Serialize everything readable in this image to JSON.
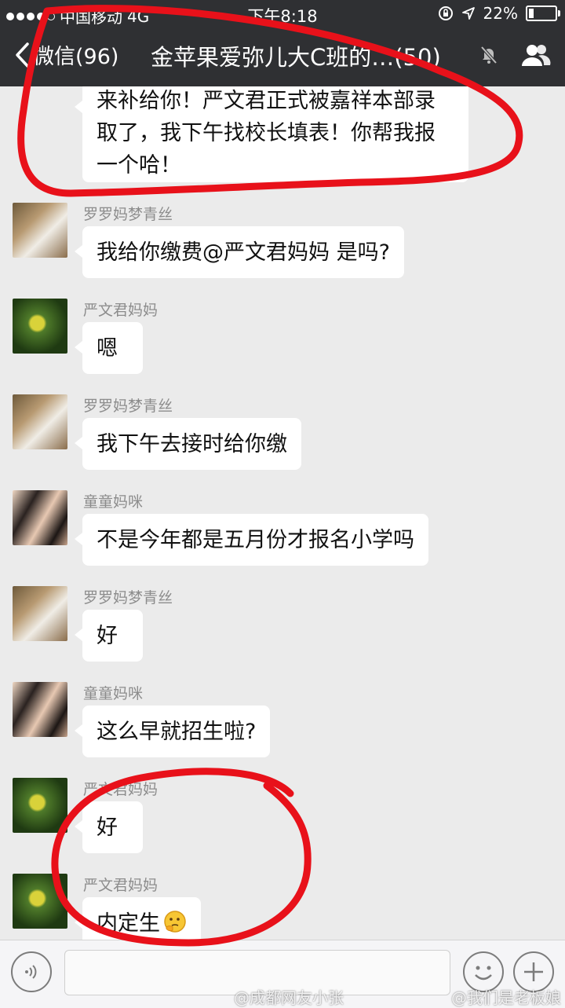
{
  "status_bar": {
    "carrier": "中国移动",
    "network": "4G",
    "time": "下午8:18",
    "battery_percent": "22%",
    "battery_level": 0.22
  },
  "nav": {
    "back_label": "微信(96)",
    "title": "金苹果爱弥儿大C班的…(50)",
    "icons": [
      "chevron-left-icon",
      "mute-icon",
      "group-members-icon"
    ]
  },
  "messages": [
    {
      "sender": "",
      "avatar": "none",
      "lines": [
        "来补给你！严文君正式被嘉祥本部录",
        "取了，我下午找校长填表！你帮我报",
        "一个哈！"
      ]
    },
    {
      "sender": "罗罗妈梦青丝",
      "avatar": "luo",
      "text": "我给你缴费@严文君妈妈 是吗?"
    },
    {
      "sender": "严文君妈妈",
      "avatar": "yan",
      "text": "嗯"
    },
    {
      "sender": "罗罗妈梦青丝",
      "avatar": "luo",
      "text": "我下午去接时给你缴"
    },
    {
      "sender": "童童妈咪",
      "avatar": "tong",
      "text": "不是今年都是五月份才报名小学吗"
    },
    {
      "sender": "罗罗妈梦青丝",
      "avatar": "luo",
      "text": "好"
    },
    {
      "sender": "童童妈咪",
      "avatar": "tong",
      "text": "这么早就招生啦?"
    },
    {
      "sender": "严文君妈妈",
      "avatar": "yan",
      "text": "好"
    },
    {
      "sender": "严文君妈妈",
      "avatar": "yan",
      "text": "内定生",
      "emoji": "thinking-face-icon"
    }
  ],
  "input_bar": {
    "icons": [
      "voice-icon",
      "emoji-icon",
      "plus-icon"
    ]
  },
  "watermarks": [
    "@成都网友小张",
    "@我们是老板娘"
  ],
  "colors": {
    "header_bg": "#2f3033",
    "chat_bg": "#ebebeb",
    "bubble_bg": "#ffffff",
    "annotation_red": "#e8111a"
  }
}
